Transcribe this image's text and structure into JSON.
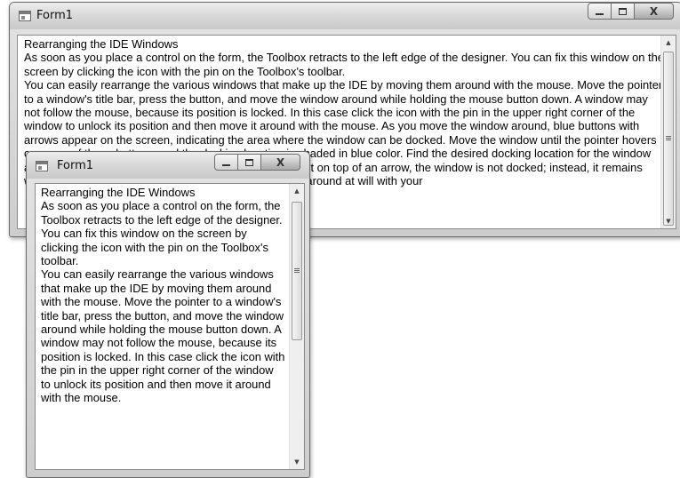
{
  "back_window": {
    "title": "Form1",
    "paragraphs": [
      "Rearranging the IDE Windows",
      "As soon as you place a control on the form, the Toolbox retracts to the left edge of the designer. You can fix this window on the screen by clicking the icon with the pin on the Toolbox's toolbar.",
      "You can easily rearrange the various windows that make up the IDE by moving them around with the mouse. Move the pointer to a window's title bar, press the button, and move the window around while holding the mouse button down. A window may not follow the mouse, because its position is locked. In this case click the icon with the pin in the upper right corner of the window to unlock its position and then move it around with the mouse. As you move the window around, blue buttons with arrows appear on the screen, indicating the area where the window can be docked. Move the window until the pointer hovers over one of these buttons, and the docking location is shaded in blue color. Find the desired docking location for the window and release the mouse button. If the mouse pointer is not on top of an arrow, the window is not docked; instead, it remains where it was, as a floating window and you can move it around at will with your"
    ]
  },
  "front_window": {
    "title": "Form1",
    "paragraphs": [
      "Rearranging the IDE Windows",
      "As soon as you place a control on the form, the Toolbox retracts to the left edge of the designer. You can fix this window on the screen by clicking the icon with the pin on the Toolbox's toolbar.",
      "You can easily rearrange the various windows that make up the IDE by moving them around with the mouse. Move the pointer to a window's title bar, press the button, and move the window around while holding the mouse button down. A window may not follow the mouse, because its position is locked. In this case click the icon with the pin in the upper right corner of the window to unlock its position and then move it around with the mouse."
    ]
  },
  "caption_buttons": {
    "close_glyph": "X"
  },
  "scrollbar": {
    "up_glyph": "▲",
    "down_glyph": "▼"
  }
}
